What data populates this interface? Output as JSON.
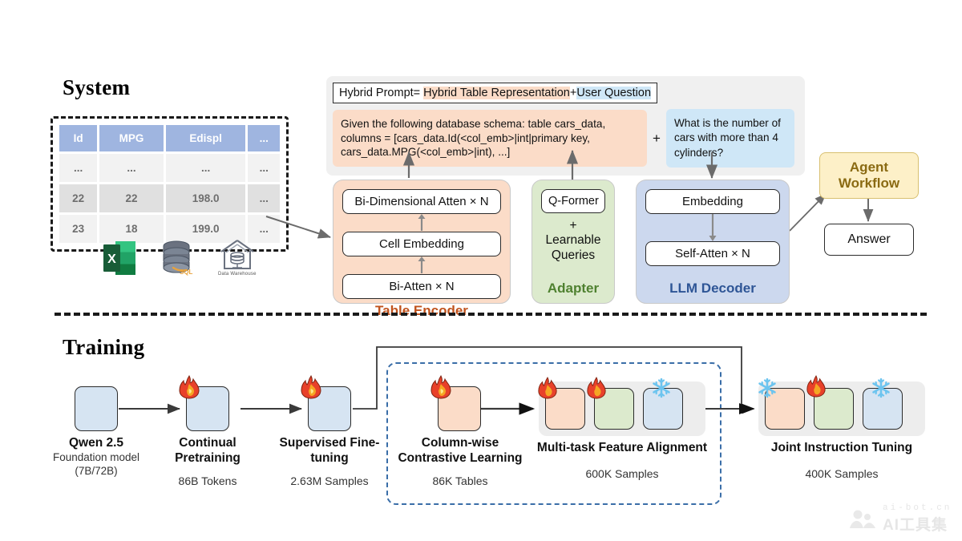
{
  "sections": {
    "system_title": "System",
    "training_title": "Training"
  },
  "source_table": {
    "headers": [
      "Id",
      "MPG",
      "Edispl",
      "..."
    ],
    "rows": [
      [
        "...",
        "...",
        "...",
        "..."
      ],
      [
        "22",
        "22",
        "198.0",
        "..."
      ],
      [
        "23",
        "18",
        "199.0",
        "..."
      ]
    ]
  },
  "data_sources": [
    {
      "name": "excel-icon",
      "caption": ""
    },
    {
      "name": "mysql-icon",
      "caption": ""
    },
    {
      "name": "data-warehouse-icon",
      "caption": "Data Warehouse"
    }
  ],
  "prompt": {
    "title_prefix": "Hybrid Prompt= ",
    "title_rep": "Hybrid Table Representation",
    "title_join": "+",
    "title_question": "User Question",
    "schema_text": "Given the following database schema: table cars_data, columns = [cars_data.Id(<col_emb>|int|primary key, cars_data.MPG(<col_emb>|int), ...]",
    "plus": "+",
    "question_text": "What is the number of cars with more than 4 cylinders?"
  },
  "modules": {
    "table_encoder": {
      "label": "Table Encoder",
      "color": "#c0531d",
      "blocks": [
        "Bi-Dimensional Atten × N",
        "Cell Embedding",
        "Bi-Atten × N"
      ]
    },
    "adapter": {
      "label": "Adapter",
      "color": "#4f8130",
      "block": "Q-Former",
      "plus": "+",
      "text_line1": "Learnable",
      "text_line2": "Queries"
    },
    "llm_decoder": {
      "label": "LLM Decoder",
      "color": "#2e5596",
      "blocks": [
        "Embedding",
        "Self-Atten × N"
      ]
    }
  },
  "outputs": {
    "agent_workflow_line1": "Agent",
    "agent_workflow_line2": "Workflow",
    "answer": "Answer"
  },
  "training_stages": [
    {
      "name": "Qwen 2.5",
      "sub_line1": "Foundation model",
      "sub_line2": "(7B/72B)",
      "metric": "",
      "state": "none"
    },
    {
      "name": "Continual Pretraining",
      "metric": "86B Tokens",
      "state": "fire"
    },
    {
      "name": "Supervised Fine-tuning",
      "metric": "2.63M Samples",
      "state": "fire"
    },
    {
      "name": "Column-wise Contrastive Learning",
      "metric": "86K Tables",
      "state": "fire"
    },
    {
      "name": "Multi-task Feature Alignment",
      "metric": "600K Samples",
      "state": "fire-fire-snow"
    },
    {
      "name": "Joint Instruction Tuning",
      "metric": "400K Samples",
      "state": "snow-fire-snow"
    }
  ],
  "watermark": {
    "top": "ai-bot.cn",
    "bottom": "AI工具集"
  },
  "colors": {
    "table_header": "#9fb5e0",
    "encoder": "#fbdcc8",
    "adapter": "#dceacd",
    "decoder": "#ccd8ee",
    "agent": "#fdf0c8",
    "dashed_group": "#3a6ea8"
  }
}
